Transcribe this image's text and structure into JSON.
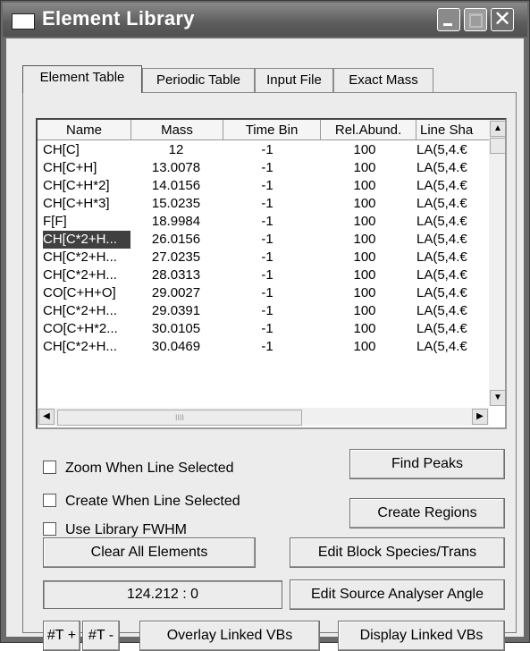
{
  "window": {
    "title": "Element Library"
  },
  "tabs": [
    {
      "label": "Element Table"
    },
    {
      "label": "Periodic Table"
    },
    {
      "label": "Input File"
    },
    {
      "label": "Exact Mass"
    }
  ],
  "table": {
    "columns": [
      "Name",
      "Mass",
      "Time Bin",
      "Rel.Abund.",
      "Line Sha"
    ],
    "rows": [
      {
        "name": "CH[C]",
        "mass": "12",
        "time_bin": "-1",
        "rel_abund": "100",
        "line": "LA(5,4.€"
      },
      {
        "name": "CH[C+H]",
        "mass": "13.0078",
        "time_bin": "-1",
        "rel_abund": "100",
        "line": "LA(5,4.€"
      },
      {
        "name": "CH[C+H*2]",
        "mass": "14.0156",
        "time_bin": "-1",
        "rel_abund": "100",
        "line": "LA(5,4.€"
      },
      {
        "name": "CH[C+H*3]",
        "mass": "15.0235",
        "time_bin": "-1",
        "rel_abund": "100",
        "line": "LA(5,4.€"
      },
      {
        "name": "F[F]",
        "mass": "18.9984",
        "time_bin": "-1",
        "rel_abund": "100",
        "line": "LA(5,4.€"
      },
      {
        "name": "CH[C*2+H...",
        "mass": "26.0156",
        "time_bin": "-1",
        "rel_abund": "100",
        "line": "LA(5,4.€"
      },
      {
        "name": "CH[C*2+H...",
        "mass": "27.0235",
        "time_bin": "-1",
        "rel_abund": "100",
        "line": "LA(5,4.€"
      },
      {
        "name": "CH[C*2+H...",
        "mass": "28.0313",
        "time_bin": "-1",
        "rel_abund": "100",
        "line": "LA(5,4.€"
      },
      {
        "name": "CO[C+H+O]",
        "mass": "29.0027",
        "time_bin": "-1",
        "rel_abund": "100",
        "line": "LA(5,4.€"
      },
      {
        "name": "CH[C*2+H...",
        "mass": "29.0391",
        "time_bin": "-1",
        "rel_abund": "100",
        "line": "LA(5,4.€"
      },
      {
        "name": "CO[C+H*2...",
        "mass": "30.0105",
        "time_bin": "-1",
        "rel_abund": "100",
        "line": "LA(5,4.€"
      },
      {
        "name": "CH[C*2+H...",
        "mass": "30.0469",
        "time_bin": "-1",
        "rel_abund": "100",
        "line": "LA(5,4.€"
      }
    ],
    "selected_row_index": 5,
    "scroll_up_glyph": "▲",
    "scroll_down_glyph": "▼",
    "scroll_left_glyph": "◀",
    "scroll_right_glyph": "▶",
    "hthumb_grip": "IIII"
  },
  "options": {
    "zoom_when_selected": "Zoom When Line Selected",
    "create_when_selected": "Create When Line Selected",
    "use_library_fwhm": "Use Library FWHM"
  },
  "buttons": {
    "find_peaks": "Find Peaks",
    "create_regions": "Create Regions",
    "clear_all": "Clear All Elements",
    "edit_block": "Edit Block Species/Trans",
    "edit_source": "Edit Source Analyser Angle",
    "t_plus": "#T +",
    "t_minus": "#T -",
    "overlay_linked": "Overlay Linked VBs",
    "display_linked": "Display Linked VBs"
  },
  "readout": "124.212 : 0",
  "titlebar": {
    "close_glyph": "✕"
  }
}
